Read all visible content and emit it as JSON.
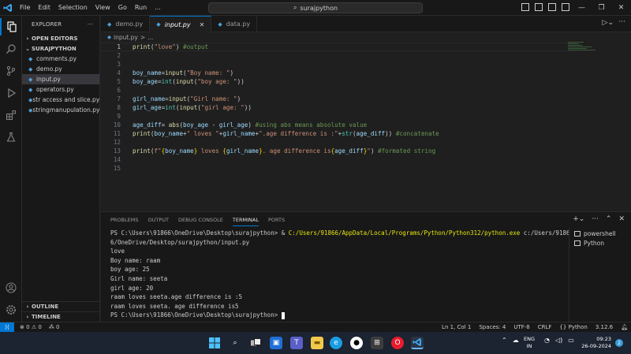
{
  "titlebar": {
    "menu": [
      "File",
      "Edit",
      "Selection",
      "View",
      "Go",
      "Run",
      "..."
    ],
    "search": "surajpython"
  },
  "sidebar": {
    "title": "EXPLORER",
    "open_editors": "OPEN EDITORS",
    "folder": "SURAJPYTHON",
    "files": [
      "comments.py",
      "demo.py",
      "input.py",
      "operators.py",
      "str access and slice.py",
      "stringmanupulation.py"
    ],
    "active_file": "input.py",
    "outline": "OUTLINE",
    "timeline": "TIMELINE"
  },
  "tabs": [
    {
      "label": "demo.py"
    },
    {
      "label": "input.py",
      "active": true
    },
    {
      "label": "data.py"
    }
  ],
  "breadcrumb": {
    "path": "input.py",
    "sep": ">",
    "tail": "..."
  },
  "editor": {
    "lines": [
      {
        "n": "1"
      },
      {
        "n": "2"
      },
      {
        "n": "3"
      },
      {
        "n": "4"
      },
      {
        "n": "5"
      },
      {
        "n": "6"
      },
      {
        "n": "7"
      },
      {
        "n": "8"
      },
      {
        "n": "9"
      },
      {
        "n": "10"
      },
      {
        "n": "11"
      },
      {
        "n": "12"
      },
      {
        "n": "13"
      },
      {
        "n": "14"
      },
      {
        "n": "15"
      }
    ],
    "code": {
      "l1": [
        "print",
        "(",
        "\"love\"",
        ") ",
        "#output"
      ],
      "l4": [
        "boy_name",
        "=",
        "input",
        "(",
        "\"Boy name: \"",
        ")"
      ],
      "l5": [
        "boy_age",
        "=",
        "int",
        "(",
        "input",
        "(",
        "\"boy age: \"",
        "))"
      ],
      "l7": [
        "girl_name",
        "=",
        "input",
        "(",
        "\"Girl name: \"",
        ")"
      ],
      "l8": [
        "girl_age",
        "=",
        "int",
        "(",
        "input",
        "(",
        "\"girl age: \"",
        "))"
      ],
      "l10": [
        "age_diff",
        "= ",
        "abs",
        "(",
        "boy_age",
        " - ",
        "girl_age",
        ") ",
        "#using abs means absolute value"
      ],
      "l11": [
        "print",
        "(",
        "boy_name",
        "+",
        "\" loves \"",
        "+",
        "girl_name",
        "+",
        "\".age difference is :\"",
        "+",
        "str",
        "(",
        "age_diff",
        ")) ",
        "#concatenate"
      ],
      "l13": [
        "print",
        "(",
        "f\"",
        "{",
        "boy_name",
        "}",
        " loves ",
        "{",
        "girl_name",
        "}",
        ". age difference is",
        "{",
        "age_diff",
        "}",
        "\"",
        ") ",
        "#formated string"
      ]
    }
  },
  "panel": {
    "tabs": [
      "PROBLEMS",
      "OUTPUT",
      "DEBUG CONSOLE",
      "TERMINAL",
      "PORTS"
    ],
    "active_tab": "TERMINAL",
    "terminal": {
      "prompt1": "PS C:\\Users\\91866\\OneDrive\\Desktop\\surajpython> ",
      "amp": "& ",
      "cmd": "C:/Users/91866/AppData/Local/Programs/Python/Python312/python.exe",
      "arg": " c:/Users/9186",
      "arg2": "6/OneDrive/Desktop/surajpython/input.py",
      "output": [
        "love",
        "Boy name: raam",
        "boy age: 25",
        "Girl name: seeta",
        "girl age: 20",
        "raam loves seeta.age difference is :5",
        "raam loves seeta. age difference is5"
      ],
      "prompt2": "PS C:\\Users\\91866\\OneDrive\\Desktop\\surajpython> "
    },
    "terminals": [
      "powershell",
      "Python"
    ]
  },
  "statusbar": {
    "errors": "0",
    "warnings": "0",
    "ports": "0",
    "position": "Ln 1, Col 1",
    "spaces": "Spaces: 4",
    "encoding": "UTF-8",
    "eol": "CRLF",
    "language": "Python",
    "version": "3.12.6"
  },
  "taskbar": {
    "lang1": "ENG",
    "lang2": "IN",
    "time": "09:23",
    "date": "26-09-2024",
    "notif": "2"
  }
}
